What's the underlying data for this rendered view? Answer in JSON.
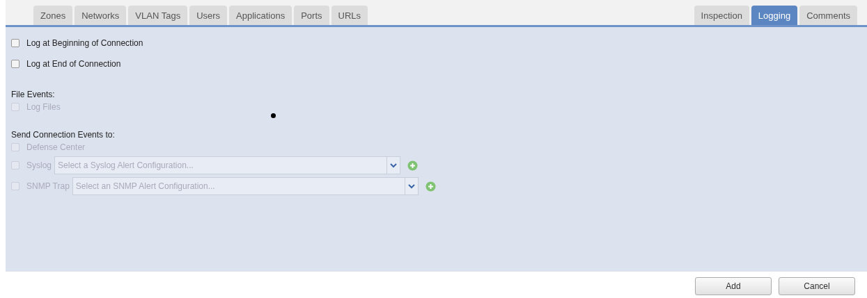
{
  "tabs_left": [
    {
      "label": "Zones",
      "selected": false
    },
    {
      "label": "Networks",
      "selected": false
    },
    {
      "label": "VLAN Tags",
      "selected": false
    },
    {
      "label": "Users",
      "selected": false
    },
    {
      "label": "Applications",
      "selected": false
    },
    {
      "label": "Ports",
      "selected": false
    },
    {
      "label": "URLs",
      "selected": false
    }
  ],
  "tabs_right": [
    {
      "label": "Inspection",
      "selected": false
    },
    {
      "label": "Logging",
      "selected": true
    },
    {
      "label": "Comments",
      "selected": false
    }
  ],
  "connection_logging": [
    {
      "label": "Log at Beginning of Connection",
      "checked": false,
      "disabled": false
    },
    {
      "label": "Log at End of Connection",
      "checked": false,
      "disabled": false
    }
  ],
  "file_events": {
    "heading": "File Events:",
    "options": [
      {
        "label": "Log Files",
        "checked": false,
        "disabled": true
      }
    ]
  },
  "send_events": {
    "heading": "Send Connection Events to:",
    "options": [
      {
        "kind": "checkbox",
        "label": "Defense Center",
        "checked": false,
        "disabled": true
      },
      {
        "kind": "select",
        "label": "Syslog",
        "checked": false,
        "disabled": true,
        "placeholder": "Select a Syslog Alert Configuration..."
      },
      {
        "kind": "select",
        "label": "SNMP Trap",
        "checked": false,
        "disabled": true,
        "placeholder": "Select an SNMP Alert Configuration..."
      }
    ]
  },
  "buttons": [
    "Add",
    "Cancel"
  ]
}
